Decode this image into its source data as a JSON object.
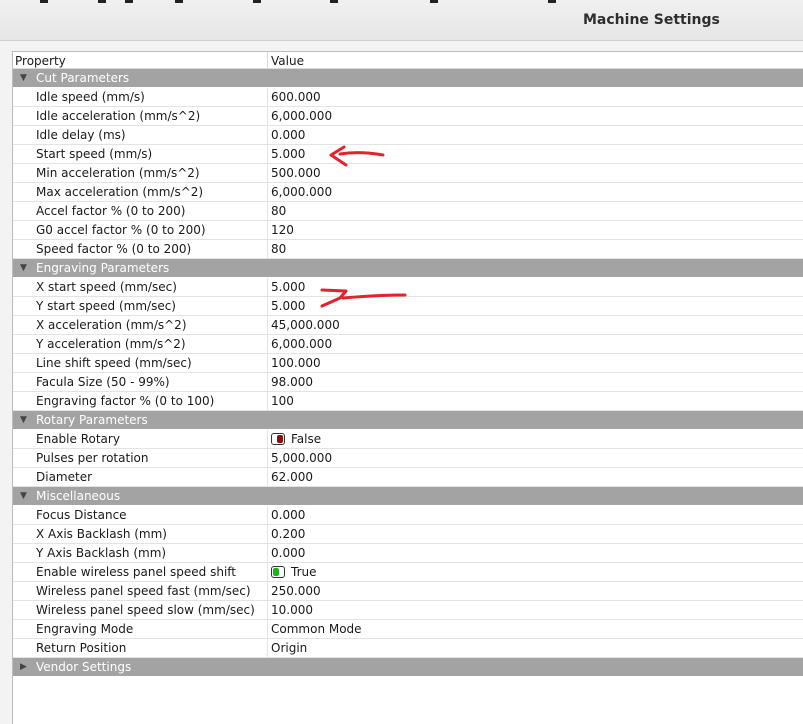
{
  "window": {
    "title": "Machine Settings"
  },
  "header": {
    "property": "Property",
    "value": "Value"
  },
  "groups": {
    "cut": {
      "label": "Cut Parameters",
      "rows": [
        {
          "p": "Idle speed (mm/s)",
          "v": "600.000"
        },
        {
          "p": "Idle acceleration (mm/s^2)",
          "v": "6,000.000"
        },
        {
          "p": "Idle delay (ms)",
          "v": "0.000"
        },
        {
          "p": "Start speed (mm/s)",
          "v": "5.000"
        },
        {
          "p": "Min acceleration (mm/s^2)",
          "v": "500.000"
        },
        {
          "p": "Max acceleration (mm/s^2)",
          "v": "6,000.000"
        },
        {
          "p": "Accel factor % (0 to 200)",
          "v": "80"
        },
        {
          "p": "G0 accel factor % (0 to 200)",
          "v": "120"
        },
        {
          "p": "Speed factor % (0 to 200)",
          "v": "80"
        }
      ]
    },
    "engraving": {
      "label": "Engraving Parameters",
      "rows": [
        {
          "p": "X start speed (mm/sec)",
          "v": "5.000"
        },
        {
          "p": "Y start speed (mm/sec)",
          "v": "5.000"
        },
        {
          "p": "X acceleration (mm/s^2)",
          "v": "45,000.000"
        },
        {
          "p": "Y acceleration (mm/s^2)",
          "v": "6,000.000"
        },
        {
          "p": "Line shift speed (mm/sec)",
          "v": "100.000"
        },
        {
          "p": "Facula Size (50 - 99%)",
          "v": "98.000"
        },
        {
          "p": "Engraving factor % (0 to 100)",
          "v": "100"
        }
      ]
    },
    "rotary": {
      "label": "Rotary Parameters",
      "rows": [
        {
          "p": "Enable Rotary",
          "v": "False",
          "toggle": "off"
        },
        {
          "p": "Pulses per rotation",
          "v": "5,000.000"
        },
        {
          "p": "Diameter",
          "v": "62.000"
        }
      ]
    },
    "misc": {
      "label": "Miscellaneous",
      "rows": [
        {
          "p": "Focus Distance",
          "v": "0.000"
        },
        {
          "p": "X Axis Backlash (mm)",
          "v": "0.200"
        },
        {
          "p": "Y Axis Backlash (mm)",
          "v": "0.000"
        },
        {
          "p": "Enable wireless panel speed shift",
          "v": "True",
          "toggle": "on"
        },
        {
          "p": "Wireless panel speed fast (mm/sec)",
          "v": "250.000"
        },
        {
          "p": "Wireless panel speed slow (mm/sec)",
          "v": "10.000"
        },
        {
          "p": "Engraving Mode",
          "v": "Common Mode"
        },
        {
          "p": "Return Position",
          "v": "Origin"
        }
      ]
    },
    "vendor": {
      "label": "Vendor Settings",
      "rows": []
    }
  },
  "colors": {
    "group_header_bg": "#a3a3a3",
    "toggle_off": "#8b0f0f",
    "toggle_on": "#16b81b",
    "annotation": "#e8202a"
  },
  "icons": {
    "expanded": "triangle-down-icon",
    "collapsed": "triangle-right-icon"
  }
}
